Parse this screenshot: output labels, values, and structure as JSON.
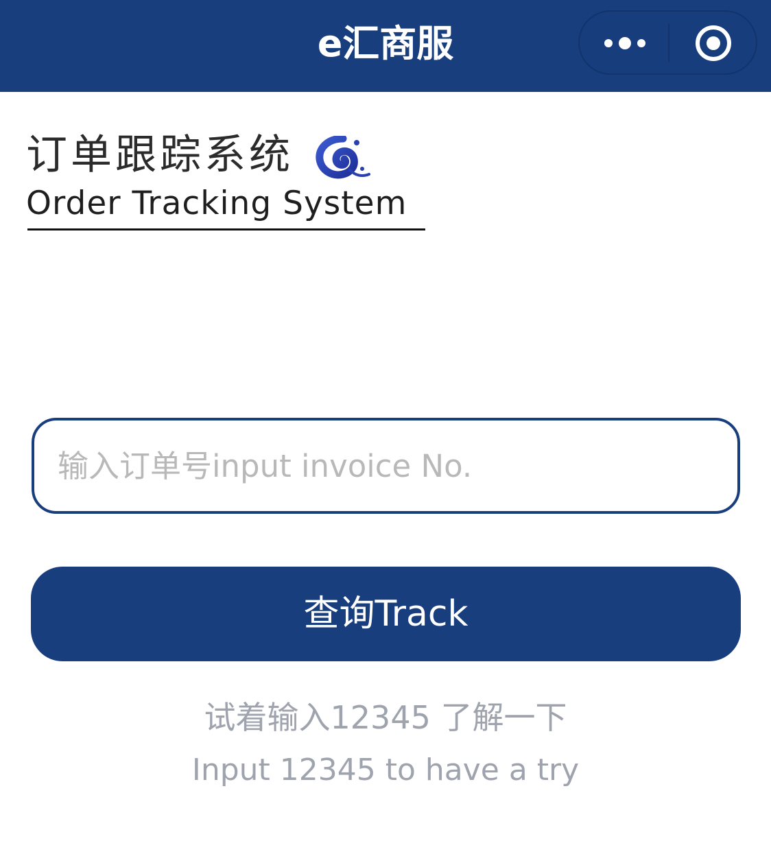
{
  "navbar": {
    "title": "e汇商服",
    "background": "#193e7e",
    "more_icon": "more-dots-icon",
    "close_icon": "target-close-icon"
  },
  "logo": {
    "title_cn": "订单跟踪系统",
    "title_en": "Order Tracking System",
    "mark_icon": "spiral-logo-icon"
  },
  "search": {
    "placeholder": "输入订单号input invoice No.",
    "value": ""
  },
  "track_button": {
    "label": "查询Track"
  },
  "hint": {
    "cn": "试着输入12345 了解一下",
    "en": "Input 12345 to have a try"
  },
  "colors": {
    "accent": "#193e7e",
    "hint_text": "#9ea3ad",
    "placeholder": "#b8b8b8"
  }
}
